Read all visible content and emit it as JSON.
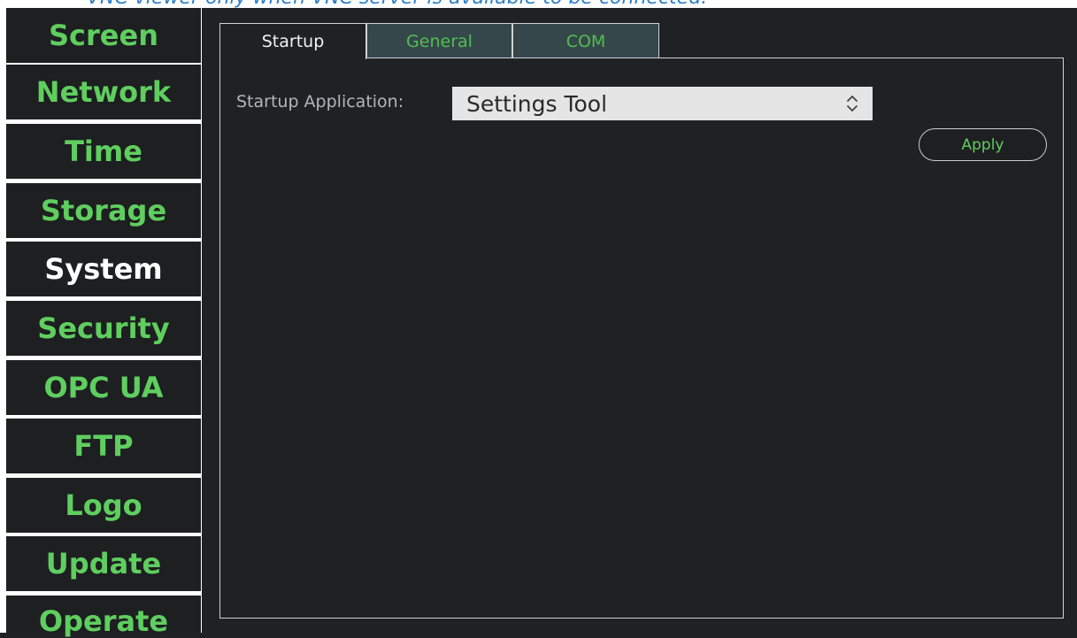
{
  "caption": "VNC viewer only when VNC server is available to be connected.",
  "sidebar": {
    "items": [
      {
        "label": "Screen"
      },
      {
        "label": "Network"
      },
      {
        "label": "Time"
      },
      {
        "label": "Storage"
      },
      {
        "label": "System",
        "active": true
      },
      {
        "label": "Security"
      },
      {
        "label": "OPC UA"
      },
      {
        "label": "FTP"
      },
      {
        "label": "Logo"
      },
      {
        "label": "Update"
      },
      {
        "label": "Operate"
      }
    ]
  },
  "tabs": [
    {
      "label": "Startup",
      "active": true
    },
    {
      "label": "General"
    },
    {
      "label": "COM"
    }
  ],
  "startup": {
    "field_label": "Startup Application:",
    "selected_value": "Settings Tool",
    "apply_label": "Apply"
  },
  "colors": {
    "accent_green": "#5fce5f",
    "background": "#1f2124",
    "inactive_tab": "#36474b",
    "caption_blue": "#2f7fc8"
  },
  "icons": {
    "select_arrows": "chevron-up-down-icon"
  }
}
